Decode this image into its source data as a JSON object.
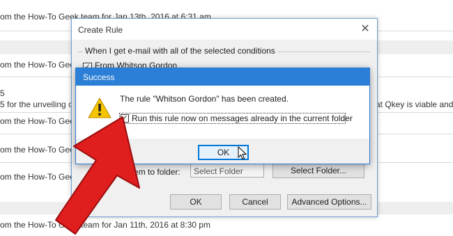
{
  "mail_list": {
    "rows": [
      {
        "text": "om the How-To Geek team for Jan 13th, 2016 at 6:31 am"
      },
      {
        "text": "om the How-To Geek team for Jan 13th, 2016 at 6:31 am"
      },
      {
        "text": "5"
      },
      {
        "text": "5 for the unveiling o"
      },
      {
        "text": "om the How-To Geek t"
      },
      {
        "text": "om the How-To Geek t"
      },
      {
        "text": "om the How-To Geek t"
      },
      {
        "text": "om the How-To Geek team for Jan 11th, 2016 at 8:30 pm"
      }
    ],
    "right_snippet": "at Qkey is viable and"
  },
  "create_rule": {
    "title": "Create Rule",
    "close_glyph": "✕",
    "group_label": "When I get e-mail with all of the selected conditions",
    "condition": "From Whitson Gordon",
    "folder_label": "the item to folder:",
    "folder_placeholder": "Select Folder",
    "select_folder_button": "Select Folder...",
    "ok_button": "OK",
    "cancel_button": "Cancel",
    "advanced_button": "Advanced Options..."
  },
  "success_dialog": {
    "title": "Success",
    "message": "The rule \"Whitson Gordon\" has been created.",
    "checkbox_label": "Run this rule now on messages already in the current folder",
    "checkbox_checked": true,
    "ok_button": "OK",
    "icon": "warning-icon"
  },
  "colors": {
    "title_blue": "#2b7fd6",
    "arrow_red": "#e01e1e",
    "warning_yellow": "#f6c400"
  }
}
